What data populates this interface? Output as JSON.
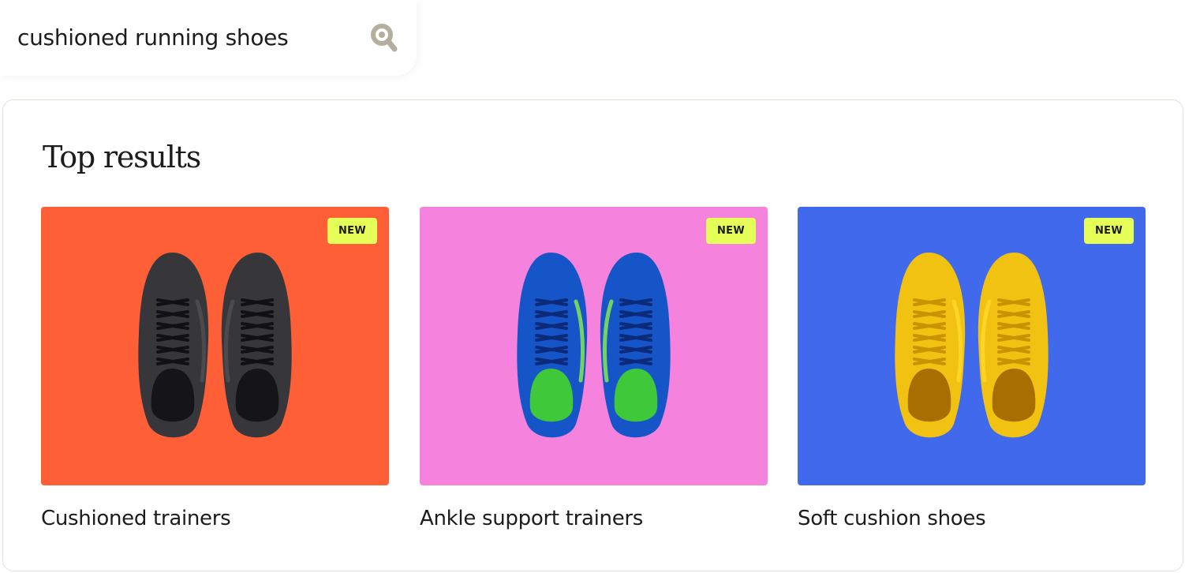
{
  "search": {
    "value": "cushioned running shoes",
    "icon": "search-icon"
  },
  "results": {
    "title": "Top results",
    "cards": [
      {
        "label": "Cushioned trainers",
        "badge": "NEW",
        "bg": "#ff5f37",
        "shoe_color": "#37373b",
        "lace_color": "#111114",
        "inner_color": "#151517",
        "trim_color": "#505055"
      },
      {
        "label": "Ankle support trainers",
        "badge": "NEW",
        "bg": "#f582dc",
        "shoe_color": "#1555c8",
        "lace_color": "#0c2a7a",
        "inner_color": "#3ec83a",
        "trim_color": "#8cf04a"
      },
      {
        "label": "Soft cushion shoes",
        "badge": "NEW",
        "bg": "#4169eb",
        "shoe_color": "#f2c212",
        "lace_color": "#c99300",
        "inner_color": "#a86e00",
        "trim_color": "#ffd82e"
      }
    ]
  }
}
